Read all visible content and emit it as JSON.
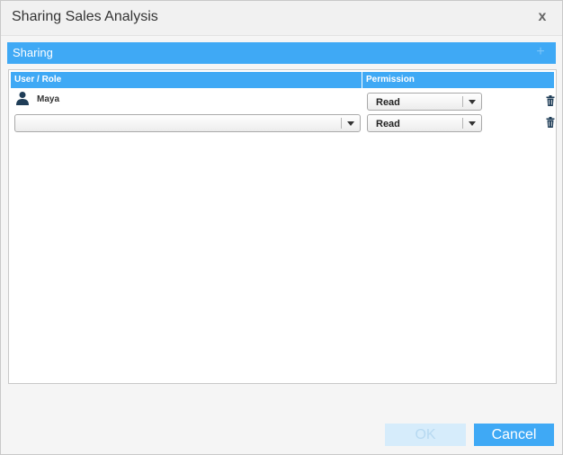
{
  "dialog": {
    "title": "Sharing Sales Analysis",
    "close_label": "x"
  },
  "section": {
    "title": "Sharing",
    "add_label": "+"
  },
  "grid": {
    "columns": [
      "User / Role",
      "Permission"
    ],
    "rows": [
      {
        "user": "Maya",
        "user_icon": "user-icon",
        "permission": "Read"
      },
      {
        "user": "",
        "permission": "Read"
      }
    ]
  },
  "footer": {
    "ok_label": "OK",
    "cancel_label": "Cancel"
  },
  "colors": {
    "accent": "#3fa9f5",
    "ok_disabled_bg": "#d6ecfb",
    "ok_disabled_text": "#b7d9f1"
  }
}
